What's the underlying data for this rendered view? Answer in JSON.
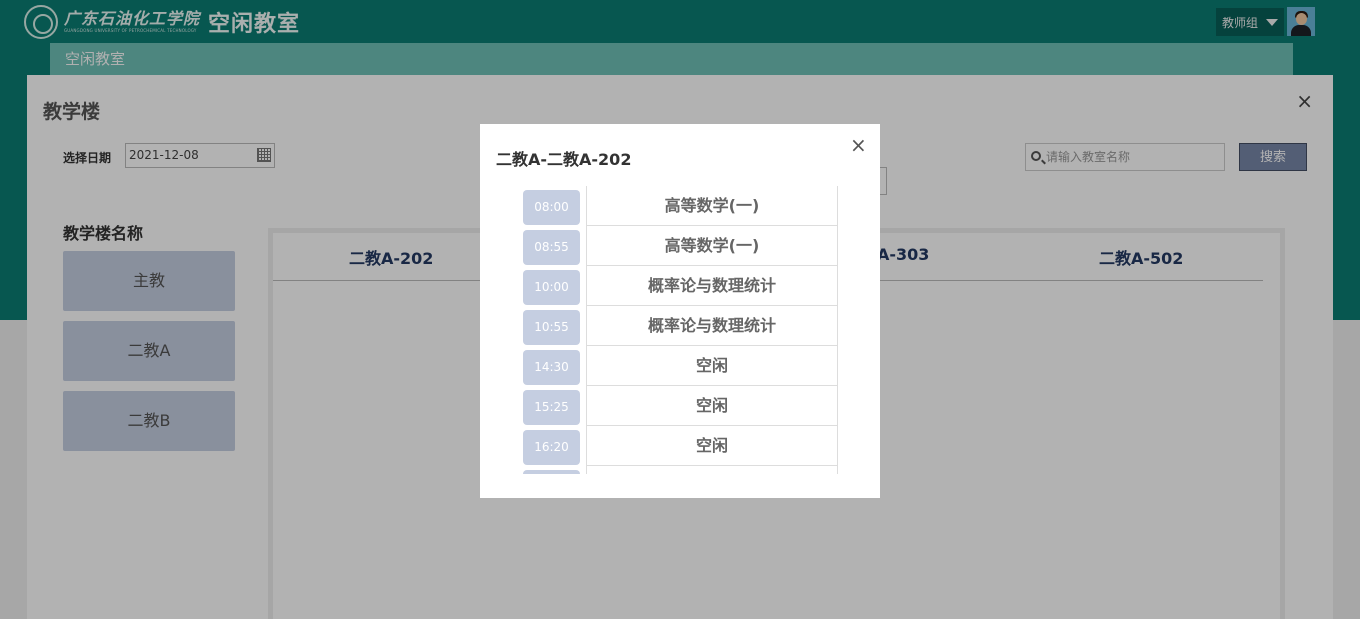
{
  "header": {
    "logo_script": "广东石油化工学院",
    "logo_sub": "GUANGDONG UNIVERSITY OF PETROCHEMICAL TECHNOLOGY",
    "app_title": "空闲教室",
    "user_group": "教师组"
  },
  "subtab": {
    "label": "空闲教室"
  },
  "panel": {
    "title": "教学楼",
    "close": "×",
    "date_label": "选择日期",
    "date_value": "2021-12-08",
    "search_placeholder": "请输入教室名称",
    "search_button": "搜索",
    "building_heading": "教学楼名称",
    "buildings": [
      "主教",
      "二教A",
      "二教B"
    ],
    "room_columns": [
      "二教A-202",
      "A-303",
      "二教A-502"
    ]
  },
  "modal": {
    "title": "二教A-二教A-202",
    "close": "×",
    "schedule": [
      {
        "time": "08:00",
        "course": "高等数学(一)"
      },
      {
        "time": "08:55",
        "course": "高等数学(一)"
      },
      {
        "time": "10:00",
        "course": "概率论与数理统计"
      },
      {
        "time": "10:55",
        "course": "概率论与数理统计"
      },
      {
        "time": "14:30",
        "course": "空闲"
      },
      {
        "time": "15:25",
        "course": "空闲"
      },
      {
        "time": "16:20",
        "course": "空闲"
      }
    ]
  },
  "colors": {
    "header_bg": "#0b7d73",
    "subtab_bg": "#6fc1b6",
    "pill_bg": "#c5cee1",
    "search_btn": "#7887a8"
  },
  "icons": [
    "school-logo-icon",
    "caret-down-icon",
    "avatar",
    "calendar-icon",
    "search-icon",
    "close-icon"
  ]
}
